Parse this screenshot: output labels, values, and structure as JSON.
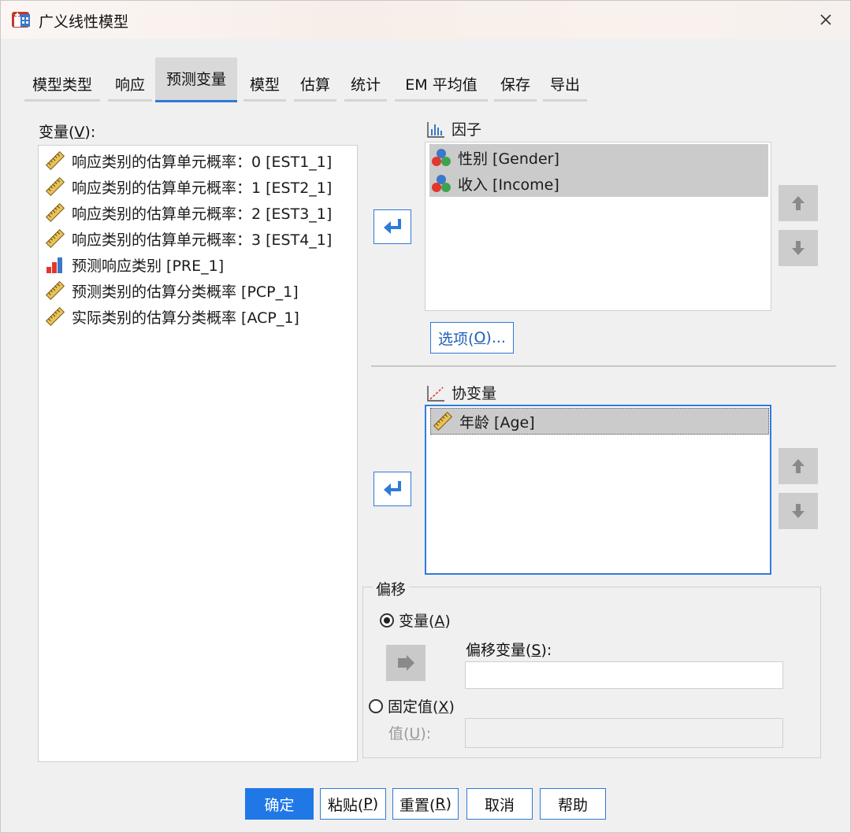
{
  "window": {
    "title": "广义线性模型"
  },
  "tabs": [
    {
      "label": "模型类型"
    },
    {
      "label": "响应"
    },
    {
      "label": "预测变量"
    },
    {
      "label": "模型"
    },
    {
      "label": "估算"
    },
    {
      "label": "统计"
    },
    {
      "label": "EM 平均值"
    },
    {
      "label": "保存"
    },
    {
      "label": "导出"
    }
  ],
  "variables": {
    "label_main": "变量(",
    "label_key": "V",
    "label_tail": "):",
    "items": [
      {
        "text": "响应类别的估算单元概率：0 [EST1_1]",
        "icon": "ruler-icon"
      },
      {
        "text": "响应类别的估算单元概率：1 [EST2_1]",
        "icon": "ruler-icon"
      },
      {
        "text": "响应类别的估算单元概率：2 [EST3_1]",
        "icon": "ruler-icon"
      },
      {
        "text": "响应类别的估算单元概率：3 [EST4_1]",
        "icon": "ruler-icon"
      },
      {
        "text": "预测响应类别 [PRE_1]",
        "icon": "bar-chart-icon"
      },
      {
        "text": "预测类别的估算分类概率 [PCP_1]",
        "icon": "ruler-icon"
      },
      {
        "text": "实际类别的估算分类概率 [ACP_1]",
        "icon": "ruler-icon"
      }
    ]
  },
  "factors": {
    "label": "因子",
    "items": [
      {
        "text": "性别 [Gender]",
        "icon": "nominal-icon"
      },
      {
        "text": "收入 [Income]",
        "icon": "nominal-icon"
      }
    ],
    "options_main": "选项(",
    "options_key": "O",
    "options_tail": ")..."
  },
  "covariates": {
    "label": "协变量",
    "items": [
      {
        "text": "年龄 [Age]",
        "icon": "ruler-icon"
      }
    ]
  },
  "offset": {
    "legend": "偏移",
    "variable_radio_main": "变量(",
    "variable_radio_key": "A",
    "variable_radio_tail": ")",
    "variable_selected": true,
    "offset_var_main": "偏移变量(",
    "offset_var_key": "S",
    "offset_var_tail": "):",
    "offset_var_value": "",
    "fixed_radio_main": "固定值(",
    "fixed_radio_key": "X",
    "fixed_radio_tail": ")",
    "value_main": "值(",
    "value_key": "U",
    "value_tail": "):",
    "value_value": ""
  },
  "buttons": {
    "ok": "确定",
    "paste_main": "粘贴(",
    "paste_key": "P",
    "paste_tail": ")",
    "reset_main": "重置(",
    "reset_key": "R",
    "reset_tail": ")",
    "cancel": "取消",
    "help": "帮助"
  },
  "colors": {
    "accent": "#2d7ad9",
    "primary_button": "#1f78e6",
    "selection": "#cbcbcb"
  }
}
